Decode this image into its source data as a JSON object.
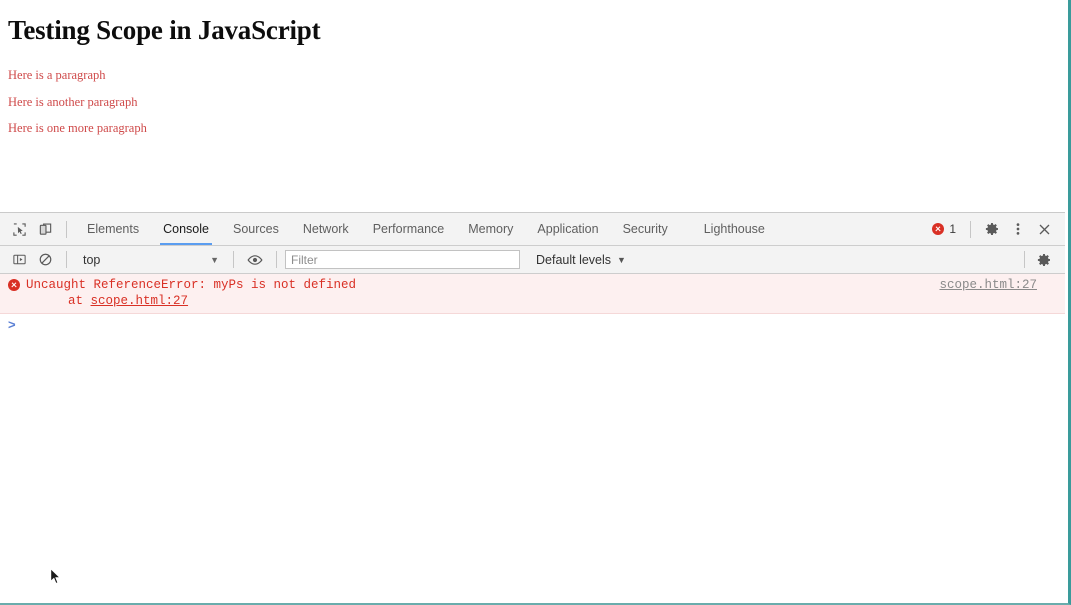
{
  "page": {
    "title": "Testing Scope in JavaScript",
    "paragraphs": [
      "Here is a paragraph",
      "Here is another paragraph",
      "Here is one more paragraph"
    ],
    "title_color": "#0d0d0d",
    "paragraph_color": "#cf4a4a"
  },
  "devtools": {
    "toolbar_icons": {
      "inspect": "inspect-element-icon",
      "device": "device-toolbar-icon"
    },
    "tabs": [
      {
        "label": "Elements",
        "active": false
      },
      {
        "label": "Console",
        "active": true
      },
      {
        "label": "Sources",
        "active": false
      },
      {
        "label": "Network",
        "active": false
      },
      {
        "label": "Performance",
        "active": false
      },
      {
        "label": "Memory",
        "active": false
      },
      {
        "label": "Application",
        "active": false
      },
      {
        "label": "Security",
        "active": false
      },
      {
        "label": "Lighthouse",
        "active": false
      }
    ],
    "active_tab_underline_color": "#5a9df0",
    "error_badge": {
      "count": "1",
      "color": "#d93025"
    },
    "settings_label": "gear-icon",
    "more_label": "kebab-menu-icon",
    "close_label": "close-icon",
    "console_toolbar": {
      "sidebar_toggle": "console-sidebar-icon",
      "clear_label": "clear-console-icon",
      "context": "top",
      "caret": "▼",
      "eye_label": "live-expression-icon",
      "filter_placeholder": "Filter",
      "filter_value": "",
      "levels": "Default levels",
      "settings": "console-settings-gear-icon"
    },
    "console": {
      "error": {
        "text": "Uncaught ReferenceError: myPs is not defined",
        "stack_prefix": "at ",
        "stack_link": "scope.html:27",
        "source_link": "scope.html:27",
        "background": "#fdf0f0",
        "text_color": "#d93025"
      },
      "prompt": ">"
    }
  }
}
